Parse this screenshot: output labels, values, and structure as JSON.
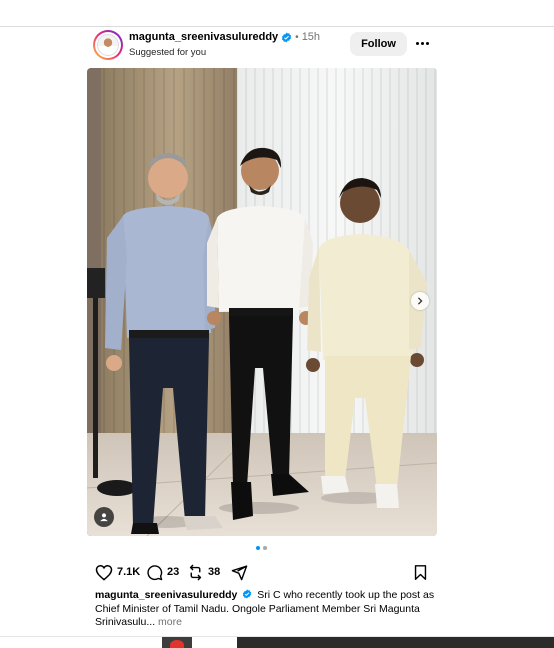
{
  "post": {
    "username": "magunta_sreenivasulureddy",
    "separator": "•",
    "time": "15h",
    "suggested": "Suggested for you",
    "follow_label": "Follow"
  },
  "stats": {
    "likes": "7.1K",
    "comments": "23",
    "reposts": "38"
  },
  "caption": {
    "username": "magunta_sreenivasulureddy",
    "text": "Sri C who recently took up the post as Chief Minister of Tamil Nadu. Ongole Parliament Member Sri Magunta Srinivasulu...",
    "more_label": "more"
  },
  "carousel": {
    "current_index": 1,
    "total": 2
  },
  "colors": {
    "verified": "#0095f6",
    "dot_active": "#0095f6",
    "dot_inactive": "#a8a8a8",
    "follow_bg": "#efefef",
    "muted_text": "#737373"
  },
  "icons": [
    "more-options-icon",
    "verified-badge-icon",
    "next-arrow-icon",
    "tag-people-icon",
    "heart-icon",
    "comment-icon",
    "repost-icon",
    "share-icon",
    "bookmark-icon"
  ]
}
